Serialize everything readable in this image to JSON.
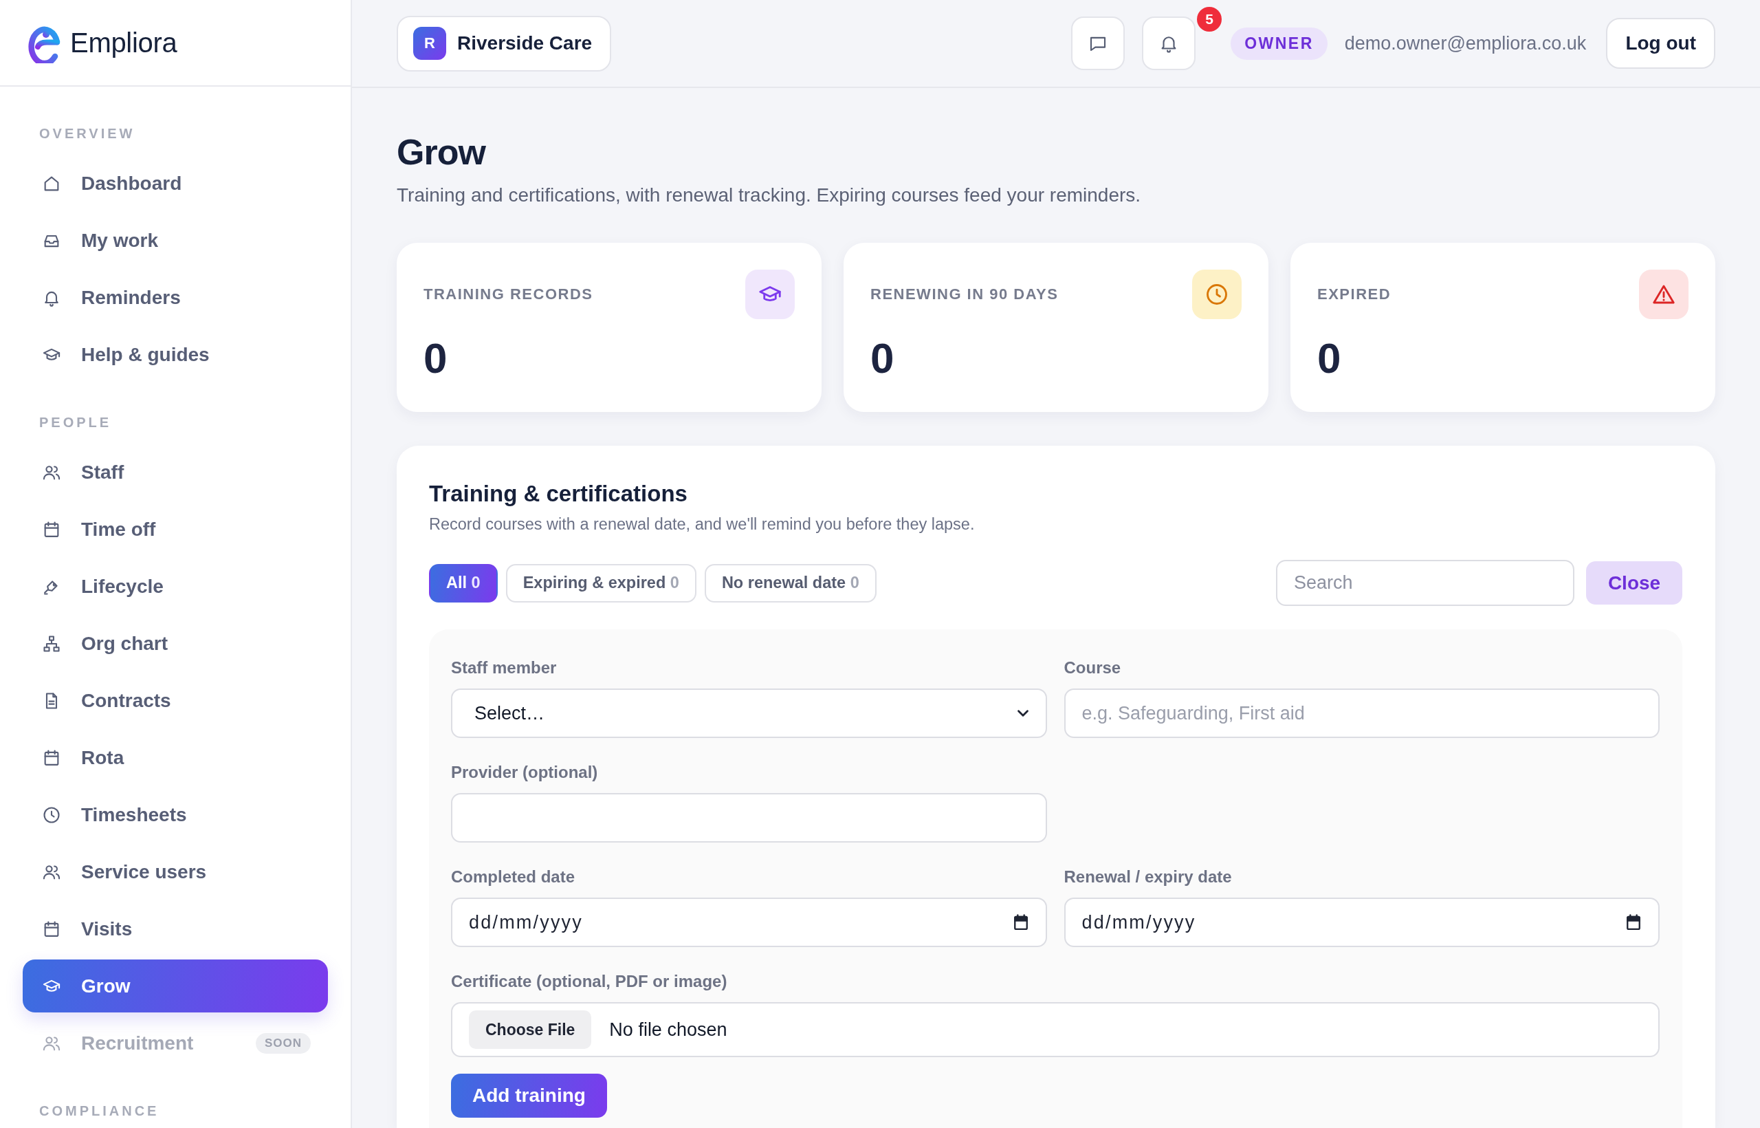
{
  "sidebar": {
    "brand": "Empliora",
    "sections": [
      {
        "heading": "OVERVIEW",
        "items": [
          {
            "label": "Dashboard",
            "selected": false,
            "disabled": false
          },
          {
            "label": "My work",
            "selected": false,
            "disabled": false
          },
          {
            "label": "Reminders",
            "selected": false,
            "disabled": false
          },
          {
            "label": "Help & guides",
            "selected": false,
            "disabled": false
          }
        ]
      },
      {
        "heading": "PEOPLE",
        "items": [
          {
            "label": "Staff",
            "selected": false,
            "disabled": false
          },
          {
            "label": "Time off",
            "selected": false,
            "disabled": false
          },
          {
            "label": "Lifecycle",
            "selected": false,
            "disabled": false
          },
          {
            "label": "Org chart",
            "selected": false,
            "disabled": false
          },
          {
            "label": "Contracts",
            "selected": false,
            "disabled": false
          },
          {
            "label": "Rota",
            "selected": false,
            "disabled": false
          },
          {
            "label": "Timesheets",
            "selected": false,
            "disabled": false
          },
          {
            "label": "Service users",
            "selected": false,
            "disabled": false
          },
          {
            "label": "Visits",
            "selected": false,
            "disabled": false
          },
          {
            "label": "Grow",
            "selected": true,
            "disabled": false
          },
          {
            "label": "Recruitment",
            "selected": false,
            "disabled": true,
            "badge": "SOON"
          }
        ]
      },
      {
        "heading": "COMPLIANCE"
      }
    ]
  },
  "topbar": {
    "org": {
      "initial": "R",
      "name": "Riverside Care"
    },
    "notification_count": "5",
    "role": "OWNER",
    "email": "demo.owner@empliora.co.uk",
    "logout": "Log out"
  },
  "page": {
    "title": "Grow",
    "subtitle": "Training and certifications, with renewal tracking. Expiring courses feed your reminders."
  },
  "stats": [
    {
      "kind": "records",
      "label": "TRAINING RECORDS",
      "value": "0"
    },
    {
      "kind": "renewal",
      "label": "RENEWING IN 90 DAYS",
      "value": "0"
    },
    {
      "kind": "expired",
      "label": "EXPIRED",
      "value": "0"
    }
  ],
  "training": {
    "title": "Training & certifications",
    "subtitle": "Record courses with a renewal date, and we'll remind you before they lapse.",
    "filters": [
      {
        "label": "All",
        "count": "0",
        "selected": true
      },
      {
        "label": "Expiring & expired",
        "count": "0",
        "selected": false
      },
      {
        "label": "No renewal date",
        "count": "0",
        "selected": false
      }
    ],
    "search": {
      "placeholder": "Search"
    },
    "close": "Close",
    "form": {
      "rows": [
        [
          {
            "kind": "select",
            "label": "Staff member",
            "value": "Select…"
          },
          {
            "kind": "text",
            "label": "Course",
            "placeholder": "e.g. Safeguarding, First aid"
          }
        ],
        [
          {
            "kind": "text",
            "label": "Provider (optional)"
          }
        ],
        [
          {
            "kind": "date",
            "label": "Completed date",
            "placeholder": "dd/mm/yyyy"
          },
          {
            "kind": "date",
            "label": "Renewal / expiry date",
            "placeholder": "dd/mm/yyyy"
          }
        ],
        [
          {
            "kind": "file",
            "label": "Certificate (optional, PDF or image)",
            "button": "Choose File",
            "value": "No file chosen"
          }
        ]
      ],
      "submit": "Add training"
    }
  }
}
